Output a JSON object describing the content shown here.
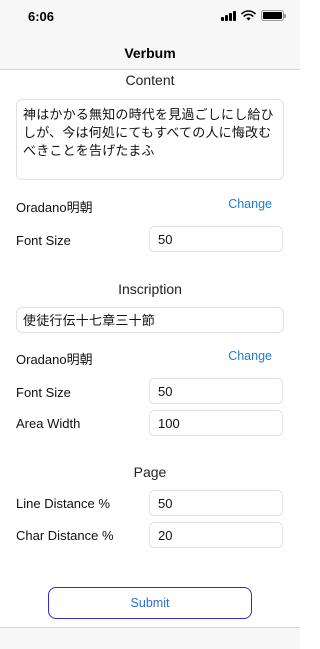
{
  "status_bar": {
    "time": "6:06"
  },
  "nav": {
    "title": "Verbum"
  },
  "content": {
    "section_title": "Content",
    "text": "神はかかる無知の時代を見過ごしにし給ひしが、今は何処にてもすべての人に悔改むべきことを告げたまふ",
    "font_name": "Oradano明朝",
    "change_label": "Change",
    "font_size_label": "Font Size",
    "font_size_value": "50"
  },
  "inscription": {
    "section_title": "Inscription",
    "text": "使徒行伝十七章三十節",
    "font_name": "Oradano明朝",
    "change_label": "Change",
    "font_size_label": "Font Size",
    "font_size_value": "50",
    "area_width_label": "Area Width",
    "area_width_value": "100"
  },
  "page": {
    "section_title": "Page",
    "line_distance_label": "Line Distance %",
    "line_distance_value": "50",
    "char_distance_label": "Char Distance %",
    "char_distance_value": "20"
  },
  "submit": {
    "label": "Submit"
  }
}
